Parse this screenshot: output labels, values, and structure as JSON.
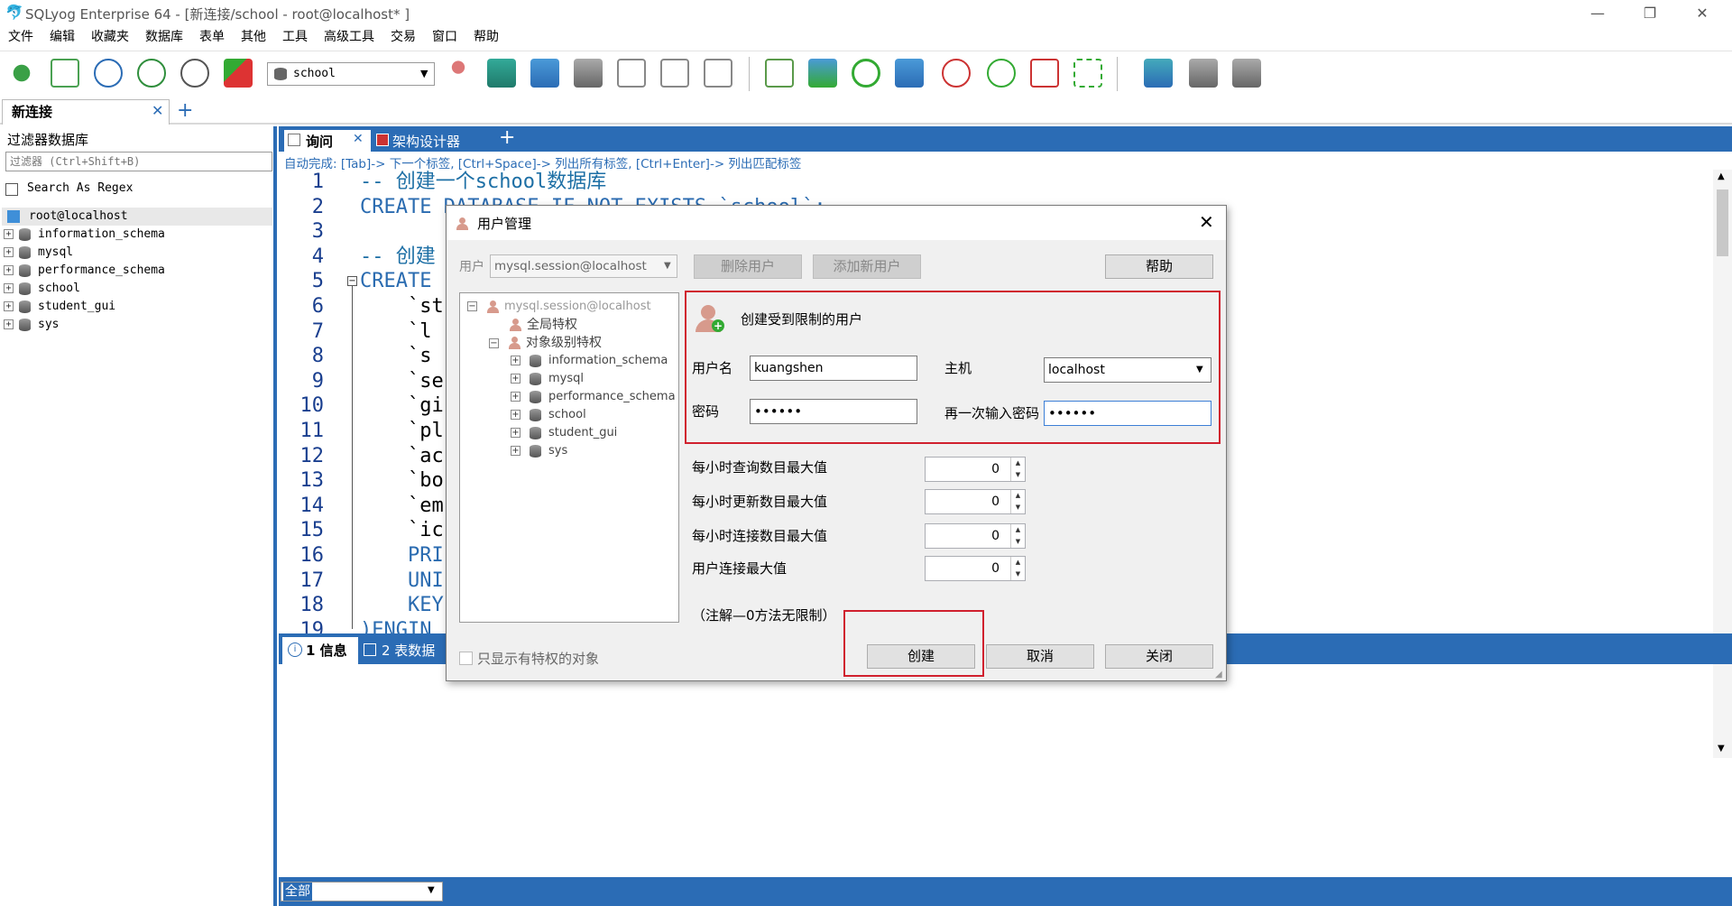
{
  "window": {
    "title": "SQLyog Enterprise 64 - [新连接/school - root@localhost* ]"
  },
  "menu": [
    "文件",
    "编辑",
    "收藏夹",
    "数据库",
    "表单",
    "其他",
    "工具",
    "高级工具",
    "交易",
    "窗口",
    "帮助"
  ],
  "toolbar": {
    "db_select": "school"
  },
  "conn_tab": {
    "label": "新连接"
  },
  "left": {
    "header": "过滤器数据库",
    "filter_placeholder": "过滤器 (Ctrl+Shift+B)",
    "regex_label": "Search As Regex",
    "root": "root@localhost",
    "dbs": [
      "information_schema",
      "mysql",
      "performance_schema",
      "school",
      "student_gui",
      "sys"
    ]
  },
  "editor": {
    "tabs": {
      "query": "询问",
      "schema": "架构设计器"
    },
    "autocomplete": "自动完成: [Tab]-> 下一个标签, [Ctrl+Space]-> 列出所有标签, [Ctrl+Enter]-> 列出匹配标签",
    "line_numbers": [
      "1",
      "2",
      "3",
      "4",
      "5",
      "6",
      "7",
      "8",
      "9",
      "10",
      "11",
      "12",
      "13",
      "14",
      "15",
      "16",
      "17",
      "18",
      "19"
    ],
    "lines": [
      {
        "text": "-- 创建一个school数据库",
        "color": "#1d6fa5"
      },
      {
        "text": "CREATE DATABASE IF NOT EXISTS `school`;",
        "color": "#2a6bb0"
      },
      {
        "text": "",
        "color": "#000"
      },
      {
        "text": "-- 创建",
        "color": "#1d6fa5"
      },
      {
        "text": "CREATE",
        "color": "#2a6bb0"
      },
      {
        "text": "    `st",
        "color": "#000"
      },
      {
        "text": "    `l",
        "color": "#000"
      },
      {
        "text": "    `s",
        "color": "#000"
      },
      {
        "text": "    `se",
        "color": "#000"
      },
      {
        "text": "    `gi",
        "color": "#000"
      },
      {
        "text": "    `pl",
        "color": "#000"
      },
      {
        "text": "    `ac",
        "color": "#000"
      },
      {
        "text": "    `bo",
        "color": "#000"
      },
      {
        "text": "    `em",
        "color": "#000"
      },
      {
        "text": "    `ic",
        "color": "#000"
      },
      {
        "text": "    PRI",
        "color": "#2a6bb0"
      },
      {
        "text": "    UNI",
        "color": "#2a6bb0"
      },
      {
        "text": "    KEY",
        "color": "#2a6bb0"
      },
      {
        "text": ")ENGIN",
        "color": "#2a6bb0"
      }
    ]
  },
  "results": {
    "tab1": "1 信息",
    "tab2": "2 表数据",
    "filter": "全部"
  },
  "dialog": {
    "title": "用户管理",
    "user_label": "用户",
    "user_value": "mysql.session@localhost",
    "delete_user": "删除用户",
    "add_user": "添加新用户",
    "help": "帮助",
    "tree": {
      "user": "mysql.session@localhost",
      "global": "全局特权",
      "object": "对象级别特权",
      "dbs": [
        "information_schema",
        "mysql",
        "performance_schema",
        "school",
        "student_gui",
        "sys"
      ]
    },
    "create_header": "创建受到限制的用户",
    "username_label": "用户名",
    "username_value": "kuangshen",
    "host_label": "主机",
    "host_value": "localhost",
    "password_label": "密码",
    "password_value": "••••••",
    "confirm_label": "再一次输入密码",
    "confirm_value": "••••••",
    "limits": [
      {
        "label": "每小时查询数目最大值",
        "value": "0"
      },
      {
        "label": "每小时更新数目最大值",
        "value": "0"
      },
      {
        "label": "每小时连接数目最大值",
        "value": "0"
      },
      {
        "label": "用户连接最大值",
        "value": "0"
      }
    ],
    "note": "（注解—0方法无限制）",
    "only_priv": "只显示有特权的对象",
    "create_btn": "创建",
    "cancel_btn": "取消",
    "close_btn": "关闭"
  },
  "colors": {
    "accent": "#2b6cb5",
    "highlight": "#d0202e"
  }
}
